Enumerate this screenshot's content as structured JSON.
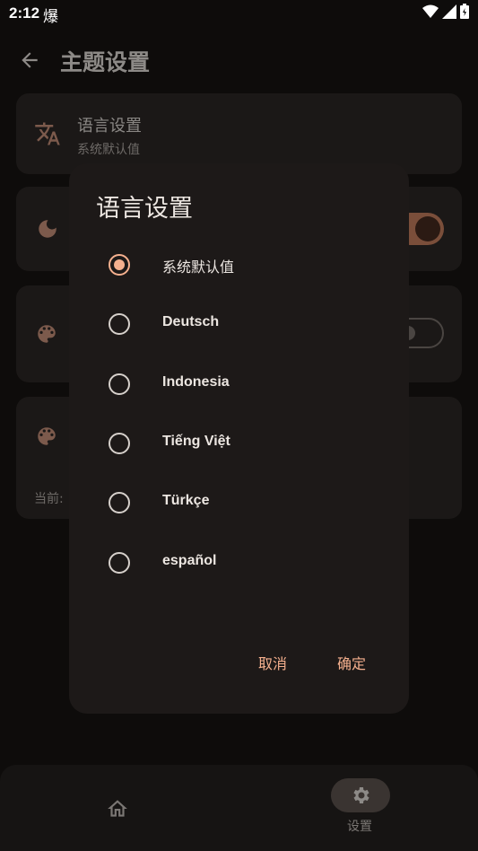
{
  "status": {
    "time": "2:12",
    "left_icon": "爆"
  },
  "appbar": {
    "title": "主题设置"
  },
  "cards": {
    "language": {
      "title": "语言设置",
      "subtitle": "系统默认值"
    },
    "current_prefix": "当前:"
  },
  "dialog": {
    "title": "语言设置",
    "options": [
      {
        "label": "系统默认值",
        "selected": true
      },
      {
        "label": "Deutsch",
        "selected": false
      },
      {
        "label": "Indonesia",
        "selected": false
      },
      {
        "label": "Tiếng Việt",
        "selected": false
      },
      {
        "label": "Türkçe",
        "selected": false
      },
      {
        "label": "español",
        "selected": false
      }
    ],
    "cancel_label": "取消",
    "confirm_label": "确定"
  },
  "bottom_nav": {
    "settings_label": "设置"
  },
  "colors": {
    "accent": "#f5b08e",
    "dialog_bg": "#1d1918",
    "scrim_bg": "#0e0c0b"
  }
}
